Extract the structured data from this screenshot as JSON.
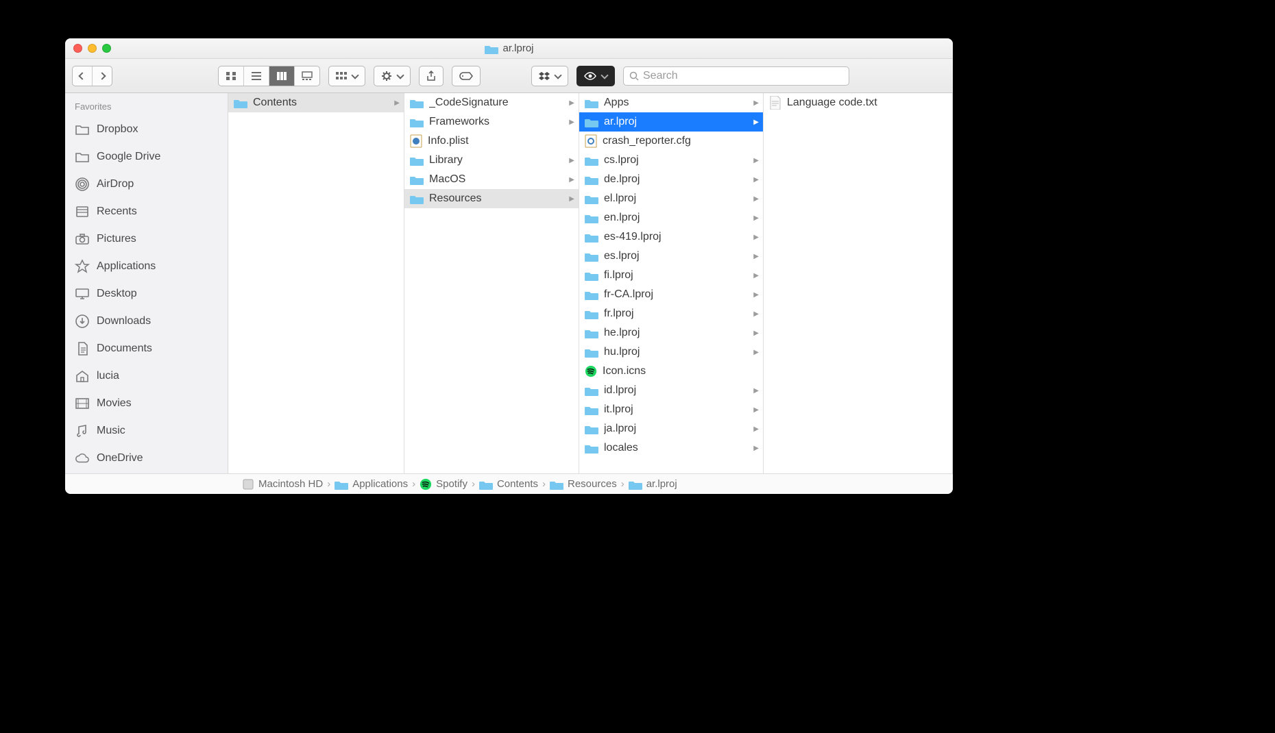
{
  "window": {
    "title": "ar.lproj"
  },
  "toolbar": {
    "search_placeholder": "Search"
  },
  "sidebar": {
    "header": "Favorites",
    "items": [
      {
        "label": "Dropbox",
        "icon": "folder"
      },
      {
        "label": "Google Drive",
        "icon": "folder"
      },
      {
        "label": "AirDrop",
        "icon": "airdrop"
      },
      {
        "label": "Recents",
        "icon": "recents"
      },
      {
        "label": "Pictures",
        "icon": "camera"
      },
      {
        "label": "Applications",
        "icon": "apps"
      },
      {
        "label": "Desktop",
        "icon": "desktop"
      },
      {
        "label": "Downloads",
        "icon": "download"
      },
      {
        "label": "Documents",
        "icon": "doc"
      },
      {
        "label": "lucia",
        "icon": "home"
      },
      {
        "label": "Movies",
        "icon": "movie"
      },
      {
        "label": "Music",
        "icon": "music"
      },
      {
        "label": "OneDrive",
        "icon": "cloud"
      }
    ]
  },
  "columns": [
    {
      "items": [
        {
          "name": "Contents",
          "type": "folder",
          "hasChildren": true,
          "selectedPath": true
        }
      ]
    },
    {
      "items": [
        {
          "name": "_CodeSignature",
          "type": "folder",
          "hasChildren": true
        },
        {
          "name": "Frameworks",
          "type": "folder",
          "hasChildren": true
        },
        {
          "name": "Info.plist",
          "type": "plist"
        },
        {
          "name": "Library",
          "type": "folder",
          "hasChildren": true
        },
        {
          "name": "MacOS",
          "type": "folder",
          "hasChildren": true
        },
        {
          "name": "Resources",
          "type": "folder",
          "hasChildren": true,
          "selectedPath": true
        }
      ]
    },
    {
      "items": [
        {
          "name": "Apps",
          "type": "folder",
          "hasChildren": true
        },
        {
          "name": "ar.lproj",
          "type": "folder",
          "hasChildren": true,
          "selected": true
        },
        {
          "name": "crash_reporter.cfg",
          "type": "cfg"
        },
        {
          "name": "cs.lproj",
          "type": "folder",
          "hasChildren": true
        },
        {
          "name": "de.lproj",
          "type": "folder",
          "hasChildren": true
        },
        {
          "name": "el.lproj",
          "type": "folder",
          "hasChildren": true
        },
        {
          "name": "en.lproj",
          "type": "folder",
          "hasChildren": true
        },
        {
          "name": "es-419.lproj",
          "type": "folder",
          "hasChildren": true
        },
        {
          "name": "es.lproj",
          "type": "folder",
          "hasChildren": true
        },
        {
          "name": "fi.lproj",
          "type": "folder",
          "hasChildren": true
        },
        {
          "name": "fr-CA.lproj",
          "type": "folder",
          "hasChildren": true
        },
        {
          "name": "fr.lproj",
          "type": "folder",
          "hasChildren": true
        },
        {
          "name": "he.lproj",
          "type": "folder",
          "hasChildren": true
        },
        {
          "name": "hu.lproj",
          "type": "folder",
          "hasChildren": true
        },
        {
          "name": "Icon.icns",
          "type": "spotify"
        },
        {
          "name": "id.lproj",
          "type": "folder",
          "hasChildren": true
        },
        {
          "name": "it.lproj",
          "type": "folder",
          "hasChildren": true
        },
        {
          "name": "ja.lproj",
          "type": "folder",
          "hasChildren": true
        },
        {
          "name": "locales",
          "type": "folder",
          "hasChildren": true
        }
      ]
    },
    {
      "items": [
        {
          "name": "Language code.txt",
          "type": "txt"
        }
      ]
    }
  ],
  "pathbar": [
    {
      "label": "Macintosh HD",
      "icon": "disk"
    },
    {
      "label": "Applications",
      "icon": "folder"
    },
    {
      "label": "Spotify",
      "icon": "spotify"
    },
    {
      "label": "Contents",
      "icon": "folder"
    },
    {
      "label": "Resources",
      "icon": "folder"
    },
    {
      "label": "ar.lproj",
      "icon": "folder"
    }
  ]
}
